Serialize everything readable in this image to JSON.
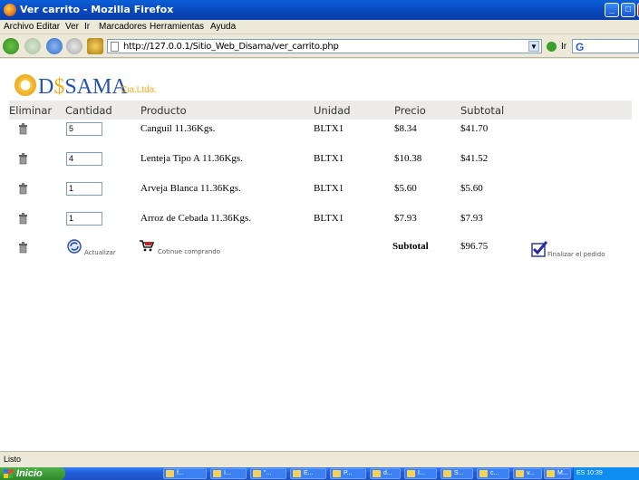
{
  "window": {
    "title": "Ver carrito - Mozilla Firefox"
  },
  "menu": {
    "items": [
      "Archivo",
      "Editar",
      "Ver",
      "Ir",
      "Marcadores",
      "Herramientas",
      "Ayuda"
    ]
  },
  "nav": {
    "url": "http://127.0.0.1/Sitio_Web_Disama/ver_carrito.php",
    "go_label": "Ir",
    "search_value": ""
  },
  "logo": {
    "brand": "D SAMA",
    "suffix": "Cia.Ltda."
  },
  "cart": {
    "columns": [
      "Eliminar",
      "Cantidad",
      "Producto",
      "Unidad",
      "Precio",
      "Subtotal"
    ],
    "rows": [
      {
        "qty": "5",
        "product": "Canguil 11.36Kgs.",
        "unit": "BLTX1",
        "price": "$8.34",
        "subtotal": "$41.70"
      },
      {
        "qty": "4",
        "product": "Lenteja Tipo A 11.36Kgs.",
        "unit": "BLTX1",
        "price": "$10.38",
        "subtotal": "$41.52"
      },
      {
        "qty": "1",
        "product": "Arveja Blanca 11.36Kgs.",
        "unit": "BLTX1",
        "price": "$5.60",
        "subtotal": "$5.60"
      },
      {
        "qty": "1",
        "product": "Arroz de Cebada 11.36Kgs.",
        "unit": "BLTX1",
        "price": "$7.93",
        "subtotal": "$7.93"
      }
    ],
    "footer": {
      "update_label": "Actualizar",
      "continue_label": "Cotinue comprando",
      "subtotal_label": "Subtotal",
      "subtotal_value": "$96.75",
      "finish_label": "Finalizar el pedido"
    }
  },
  "status": {
    "text": "Listo"
  },
  "taskbar": {
    "start_label": "Inicio",
    "items": [
      "f...",
      "I...",
      "\"...",
      "E...",
      "P...",
      "d...",
      "I...",
      "S...",
      "c...",
      "v...",
      "M..."
    ],
    "tray_text": "ES  10:39"
  }
}
